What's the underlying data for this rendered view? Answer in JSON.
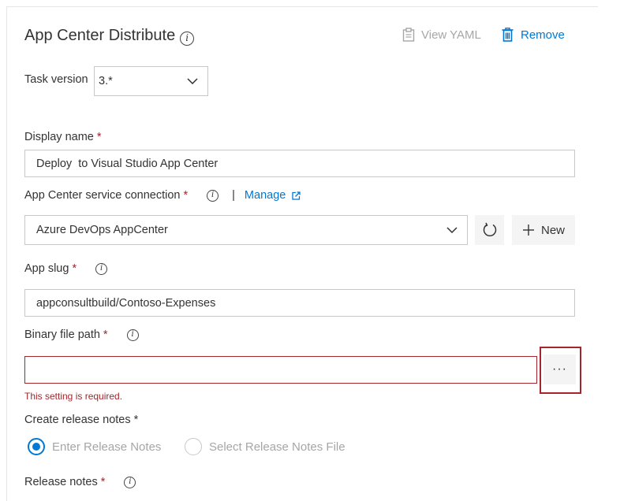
{
  "header": {
    "title": "App Center Distribute",
    "view_yaml_label": "View YAML",
    "remove_label": "Remove"
  },
  "task_version": {
    "label": "Task version",
    "value": "3.*"
  },
  "display_name": {
    "label": "Display name",
    "required_mark": "*",
    "value": "Deploy  to Visual Studio App Center"
  },
  "service_connection": {
    "label": "App Center service connection",
    "required_mark": "*",
    "separator": "|",
    "manage_label": "Manage",
    "value": "Azure DevOps AppCenter",
    "new_label": "New"
  },
  "app_slug": {
    "label": "App slug",
    "required_mark": "*",
    "value": "appconsultbuild/Contoso-Expenses"
  },
  "binary_path": {
    "label": "Binary file path",
    "required_mark": "*",
    "value": "",
    "browse_label": "···",
    "error": "This setting is required."
  },
  "release_notes_option": {
    "label": "Create release notes",
    "required_mark": "*",
    "options": [
      "Enter Release Notes",
      "Select Release Notes File"
    ],
    "selected": 0
  },
  "release_notes": {
    "label": "Release notes",
    "required_mark": "*"
  },
  "colors": {
    "accent": "#0078d4",
    "error": "#a4262c",
    "disabled": "#a6a6a6"
  }
}
